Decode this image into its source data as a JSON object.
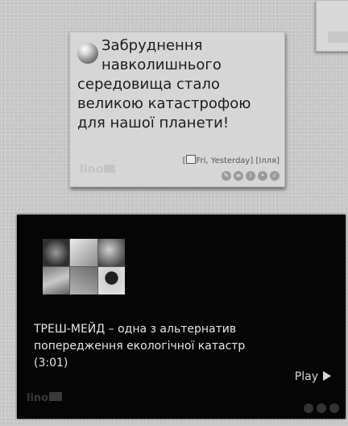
{
  "note": {
    "line1": "Забруднення",
    "line2": "навколишнього",
    "line3": "середовища стало",
    "line4": "великою катастрофою",
    "line5": "для нашої планети!",
    "date": "Fri, Yesterday",
    "author": "Ілля",
    "logo": "lino"
  },
  "video": {
    "title": "ТРЕШ-МЕЙД – одна з альтернатив попередження екологічної катастр",
    "duration": "(3:01)",
    "play_label": "Play",
    "logo": "lino"
  }
}
